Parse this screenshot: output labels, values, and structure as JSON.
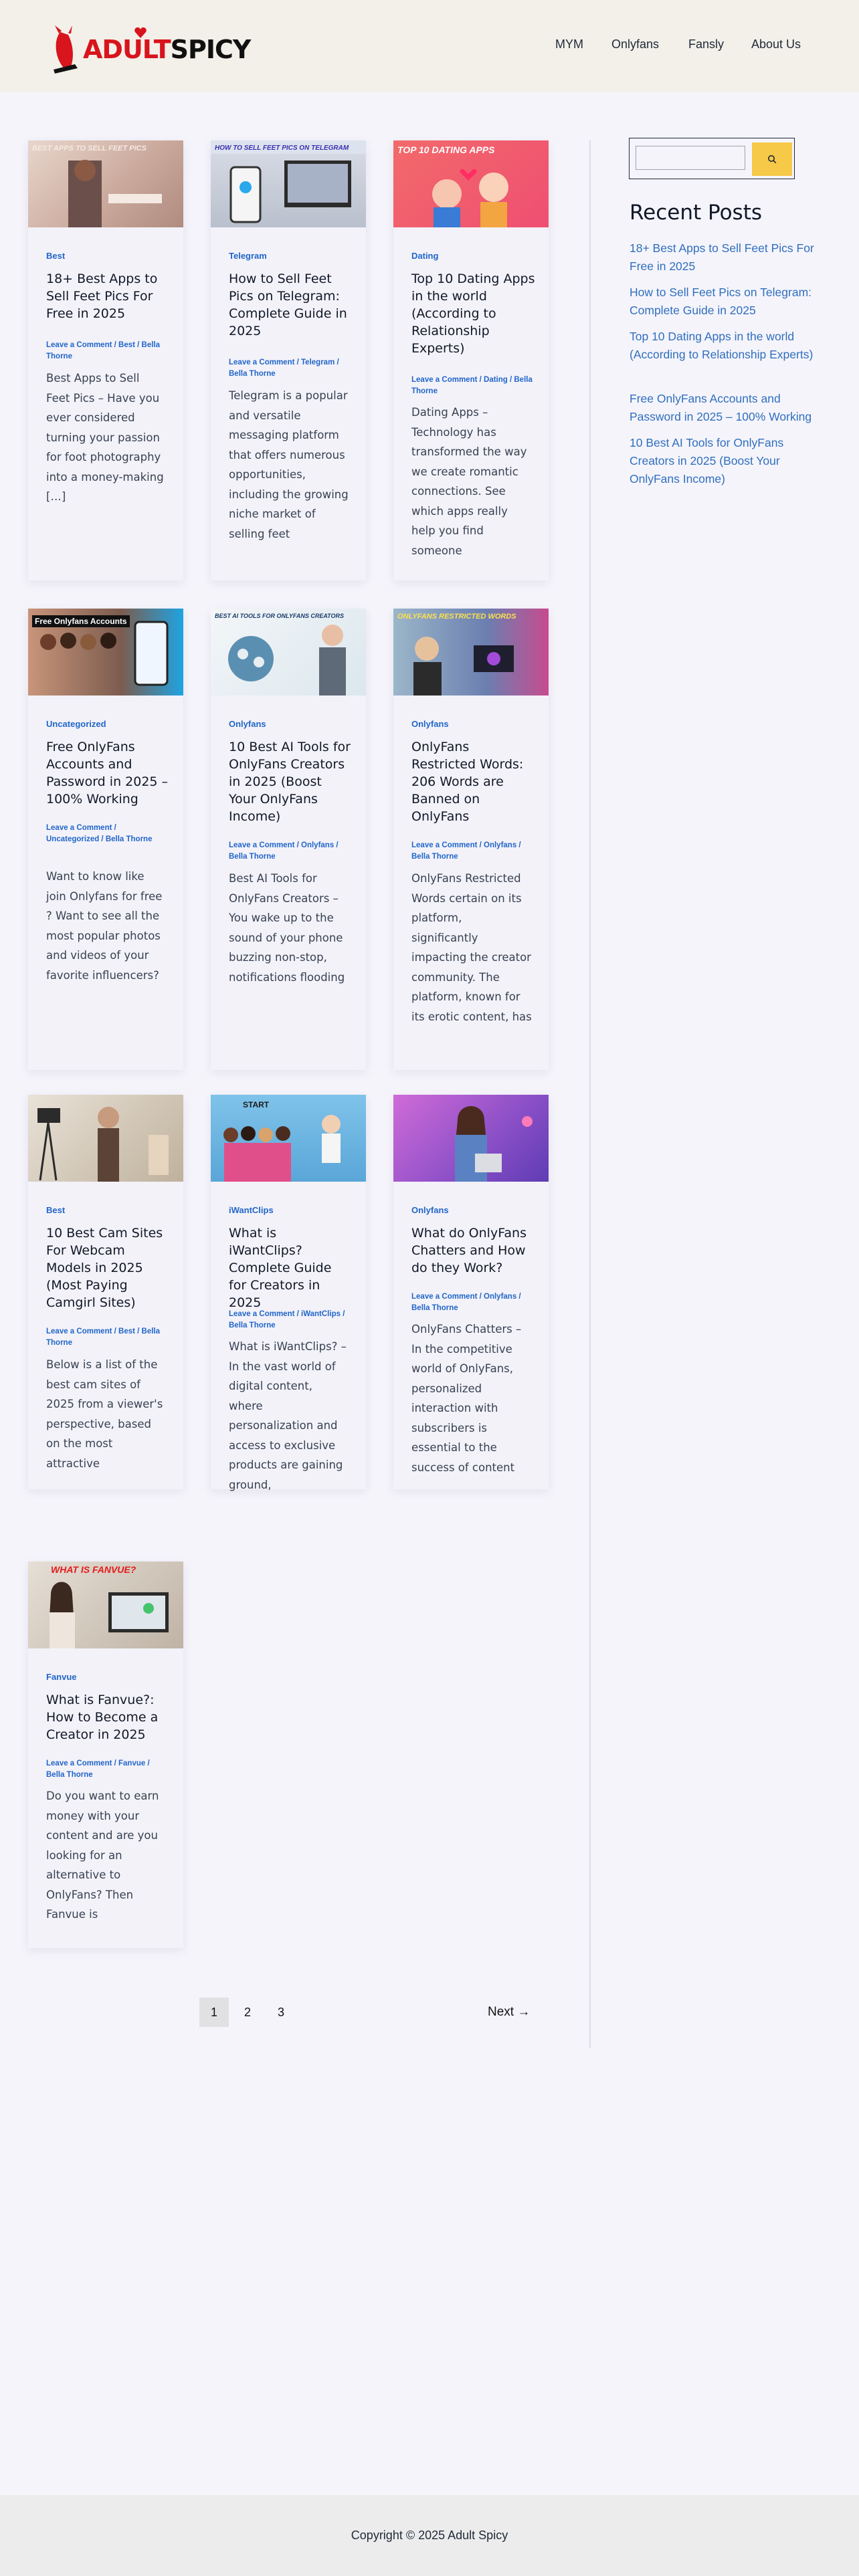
{
  "brand": {
    "logo_text_red": "ADULT",
    "logo_text_black": "SPICY"
  },
  "nav": [
    "MYM",
    "Onlyfans",
    "Fansly",
    "About Us"
  ],
  "posts": [
    {
      "thumb_label": "BEST APPS TO SELL FEET PICS",
      "category": "Best",
      "title": "18+ Best Apps to Sell Feet Pics For Free in 2025",
      "meta": "Leave a Comment / Best / Bella Thorne",
      "excerpt": "Best Apps to Sell Feet Pics – Have you ever considered turning your passion for foot photography into a money-making […]"
    },
    {
      "thumb_label": "HOW TO SELL FEET PICS ON TELEGRAM",
      "category": "Telegram",
      "title": "How to Sell Feet Pics on Telegram: Complete Guide in 2025",
      "meta": "Leave a Comment / Telegram / Bella Thorne",
      "excerpt": "Telegram is a popular and versatile messaging platform that offers numerous opportunities, including the growing niche market of selling feet"
    },
    {
      "thumb_label": "TOP 10 DATING APPS",
      "category": "Dating",
      "title": "Top 10 Dating Apps in the world (According to Relationship Experts)",
      "meta": "Leave a Comment / Dating / Bella Thorne",
      "excerpt": "Dating Apps – Technology has transformed the way we create romantic connections. See which apps really help you find someone"
    },
    {
      "thumb_label": "Free Onlyfans Accounts",
      "category": "Uncategorized",
      "title": "Free OnlyFans Accounts and Password in 2025 – 100% Working",
      "meta": "Leave a Comment / Uncategorized / Bella Thorne",
      "excerpt": "Want to know like join Onlyfans for free ? Want to see all the most popular photos and videos of your favorite influencers?"
    },
    {
      "thumb_label": "BEST AI TOOLS FOR ONLYFANS CREATORS",
      "category": "Onlyfans",
      "title": "10 Best AI Tools for OnlyFans Creators in 2025 (Boost Your OnlyFans Income)",
      "meta": "Leave a Comment / Onlyfans / Bella Thorne",
      "excerpt": "Best AI Tools for OnlyFans Creators – You wake up to the sound of your phone buzzing non-stop, notifications flooding"
    },
    {
      "thumb_label": "ONLYFANS RESTRICTED WORDS",
      "category": "Onlyfans",
      "title": "OnlyFans Restricted Words: 206 Words are Banned on OnlyFans",
      "meta": "Leave a Comment / Onlyfans / Bella Thorne",
      "excerpt": "OnlyFans Restricted Words certain on its platform, significantly impacting the creator community. The platform, known for its erotic content, has"
    },
    {
      "thumb_label": "",
      "category": "Best",
      "title": "10 Best Cam Sites For Webcam Models in 2025 (Most Paying Camgirl Sites)",
      "meta": "Leave a Comment / Best / Bella Thorne",
      "excerpt": "Below is a list of the best cam sites of 2025 from a viewer's perspective, based on the most attractive"
    },
    {
      "thumb_label": "START",
      "category": "iWantClips",
      "title": "What is iWantClips? Complete Guide for Creators in 2025",
      "meta": "Leave a Comment / iWantClips / Bella Thorne",
      "excerpt": "What is iWantClips? – In the vast world of digital content, where personalization and access to exclusive products are gaining ground,"
    },
    {
      "thumb_label": "",
      "category": "Onlyfans",
      "title": "What do OnlyFans Chatters and How do they Work?",
      "meta": "Leave a Comment / Onlyfans / Bella Thorne",
      "excerpt": "OnlyFans Chatters – In the competitive world of OnlyFans, personalized interaction with subscribers is essential to the success of content"
    },
    {
      "thumb_label": "WHAT IS FANVUE?",
      "category": "Fanvue",
      "title": "What is Fanvue?: How to Become a Creator in 2025",
      "meta": "Leave a Comment / Fanvue / Bella Thorne",
      "excerpt": "Do you want to earn money with your content and are you looking for an alternative to OnlyFans? Then Fanvue is"
    }
  ],
  "sidebar": {
    "search_placeholder": "",
    "search_icon": "search-icon",
    "recent_heading": "Recent Posts",
    "recent_posts": [
      "18+ Best Apps to Sell Feet Pics For Free in 2025",
      "How to Sell Feet Pics on Telegram: Complete Guide in 2025",
      "Top 10 Dating Apps in the world (According to Relationship Experts)",
      "Free OnlyFans Accounts and Password in 2025 – 100% Working",
      "10 Best AI Tools for OnlyFans Creators in 2025 (Boost Your OnlyFans Income)"
    ]
  },
  "pagination": {
    "pages": [
      "1",
      "2",
      "3"
    ],
    "current": "1",
    "next_label": "Next →"
  },
  "footer": {
    "copyright": "Copyright © 2025 Adult Spicy"
  },
  "colors": {
    "accent": "#2166c8",
    "link": "#2f6fbd",
    "search_button": "#f7c948",
    "logo_red": "#d8141c"
  }
}
